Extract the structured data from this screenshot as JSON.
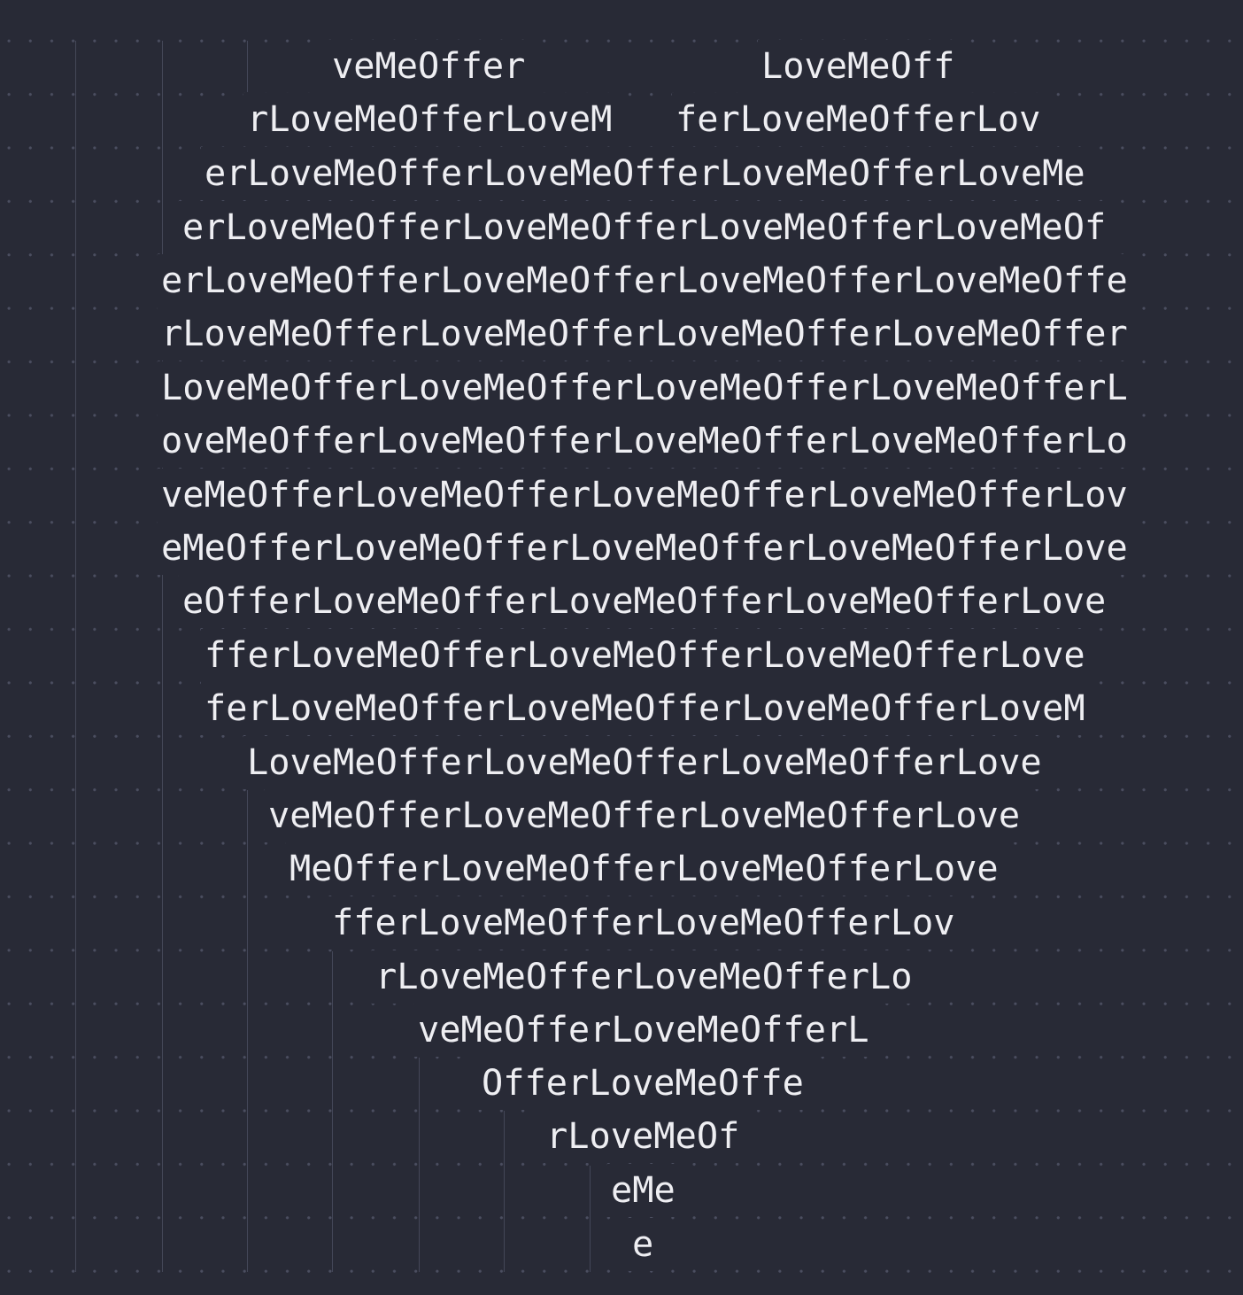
{
  "editor": {
    "theme": {
      "background": "#282a36",
      "text": "#eeeef2",
      "whitespace_dot": "#4b4e60",
      "indent_guide": "#444758"
    },
    "lines": [
      "veMeOffer",
      "LoveMeOff",
      "rLoveMeOfferLoveM",
      "ferLoveMeOfferLov",
      "erLoveMeOfferLoveMeOfferLoveMeOfferLoveMe",
      "erLoveMeOfferLoveMeOfferLoveMeOfferLoveMeOf",
      "erLoveMeOfferLoveMeOfferLoveMeOfferLoveMeOffe",
      "rLoveMeOfferLoveMeOfferLoveMeOfferLoveMeOffer",
      "LoveMeOfferLoveMeOfferLoveMeOfferLoveMeOfferL",
      "oveMeOfferLoveMeOfferLoveMeOfferLoveMeOfferLo",
      "veMeOfferLoveMeOfferLoveMeOfferLoveMeOfferLov",
      "eMeOfferLoveMeOfferLoveMeOfferLoveMeOfferLove",
      "eOfferLoveMeOfferLoveMeOfferLoveMeOfferLove",
      "fferLoveMeOfferLoveMeOfferLoveMeOfferLove",
      "ferLoveMeOfferLoveMeOfferLoveMeOfferLoveM",
      "LoveMeOfferLoveMeOfferLoveMeOfferLove",
      "veMeOfferLoveMeOfferLoveMeOfferLove",
      "MeOfferLoveMeOfferLoveMeOfferLove",
      "fferLoveMeOfferLoveMeOfferLov",
      "rLoveMeOfferLoveMeOfferLo",
      "veMeOfferLoveMeOfferL",
      "OfferLoveMeOffe",
      "rLoveMeOf",
      "eMe",
      "e"
    ]
  }
}
